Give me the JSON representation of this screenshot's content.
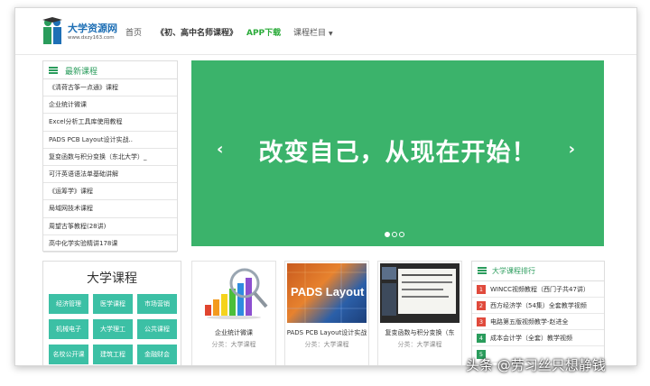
{
  "header": {
    "logo_text": "大学资源网",
    "logo_url": "www.dxzy163.com",
    "nav": {
      "home": "首页",
      "teachers": "《初、高中名师课程》",
      "app": "APP下载",
      "courses": "课程栏目"
    }
  },
  "latest": {
    "title": "最新课程",
    "items": [
      "《清荷古筝一点通》课程",
      "企业统计微课",
      "Excel分析工具库使用教程",
      "PADS PCB Layout设计实战..",
      "复变函数与积分变换（东北大学）_",
      "可汗英语语法单基础讲解",
      "《运筹学》课程",
      "局域网技术课程",
      "周望古筝教程(28讲)",
      "高中化学实验精讲178课"
    ]
  },
  "banner": {
    "text": "改变自己，从现在开始！",
    "prev": "‹",
    "next": "›"
  },
  "university": {
    "title": "大学课程",
    "tags": [
      "经济管理",
      "医学课程",
      "市场营销",
      "机械电子",
      "大学理工",
      "公共课程",
      "名校公开课",
      "建筑工程",
      "金融财会"
    ]
  },
  "cards": [
    {
      "name": "企业统计微课",
      "category_label": "分类：",
      "category": "大学课程"
    },
    {
      "name": "PADS PCB Layout设计实战",
      "category_label": "分类：",
      "category": "大学课程",
      "thumb_text": "PADS Layout"
    },
    {
      "name": "复变函数与积分变换（东",
      "category_label": "分类：",
      "category": "大学课程"
    }
  ],
  "ranking": {
    "title": "大学课程排行",
    "items": [
      {
        "num": "1",
        "text": "WINCC视频教程（西门子共47讲）",
        "color": "#e04a3c"
      },
      {
        "num": "2",
        "text": "西方经济学（54集）全套教学视频",
        "color": "#e04a3c"
      },
      {
        "num": "3",
        "text": "电路第五版视频教学-赵进全",
        "color": "#e04a3c"
      },
      {
        "num": "4",
        "text": "成本会计学（全套）教学视频",
        "color": "#2a9c5c"
      },
      {
        "num": "5",
        "text": "",
        "color": "#2a9c5c"
      }
    ]
  },
  "watermark": "头条 @劳习丝只想静钱",
  "colors": {
    "accent": "#2a9c5c",
    "banner": "#3bb36b",
    "tag": "#3cc0a5",
    "app": "#2bab3a"
  }
}
